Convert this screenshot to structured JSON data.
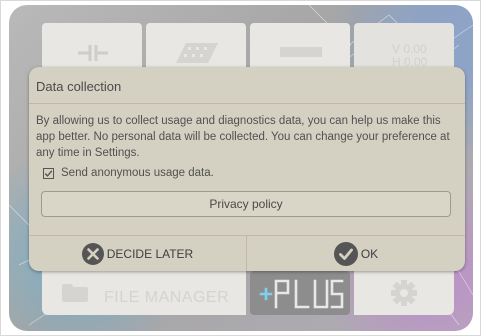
{
  "tiles": {
    "readout_v": "V 0.00",
    "readout_h": "H 0.00",
    "file_manager_label": "FILE MANAGER",
    "plus_logo_text": "PLUS"
  },
  "icons": {
    "capacitor": "capacitor-icon",
    "parallelogram": "parallelogram-icon",
    "bar": "bar-icon",
    "folder": "folder-icon",
    "gear": "gear-icon",
    "check": "checkbox-checked-icon",
    "close": "close-circle-icon",
    "ok": "check-circle-icon"
  },
  "dialog": {
    "title": "Data collection",
    "body": "By allowing us to collect usage and diagnostics data, you can help us make this app better. No personal data will be collected. You can change your preference at any time in Settings.",
    "checkbox_label": "Send anonymous usage data.",
    "checkbox_checked": true,
    "privacy_button": "Privacy policy",
    "decide_later": "DECIDE LATER",
    "ok": "OK"
  },
  "colors": {
    "dialog_bg": "#d5d1c2",
    "icon_dark": "#555555",
    "tile_bg": "#e9e7e3"
  }
}
